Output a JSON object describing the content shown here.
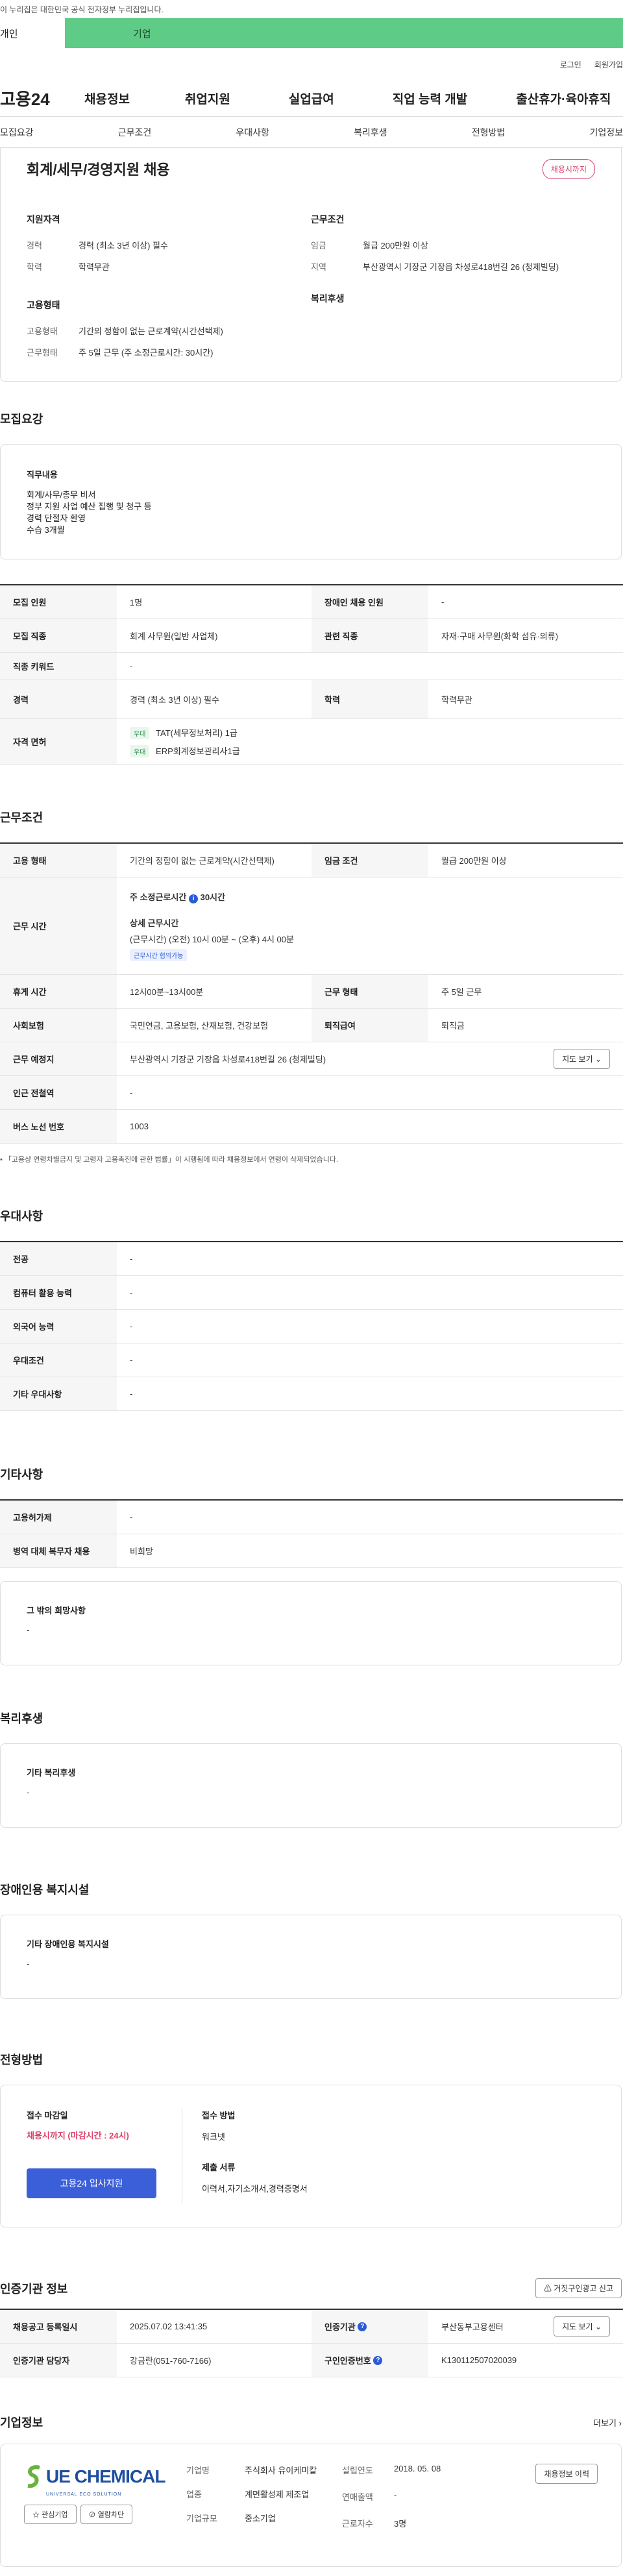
{
  "topbar": {
    "notice": "이 누리집은 대한민국 공식 전자정부 누리집입니다."
  },
  "tabs": {
    "individual": "개인",
    "corporate": "기업"
  },
  "util": {
    "login": "로그인",
    "signup": "회원가입"
  },
  "gnb": {
    "logo": "고용24",
    "menu": [
      "채용정보",
      "취업지원",
      "실업급여",
      "직업 능력 개발",
      "출산휴가·육아휴직"
    ]
  },
  "subnav": [
    "모집요강",
    "근무조건",
    "우대사항",
    "복리후생",
    "전형방법",
    "기업정보"
  ],
  "summary": {
    "title": "회계/세무/경영지원 채용",
    "status": "채용시까지",
    "qual_title": "지원자격",
    "work_title": "근무조건",
    "emp_title": "고용형태",
    "welfare_title": "복리후생",
    "career_k": "경력",
    "career_v": "경력 (최소 3년 이상) 필수",
    "edu_k": "학력",
    "edu_v": "학력무관",
    "wage_k": "임금",
    "wage_v": "월급 200만원 이상",
    "region_k": "지역",
    "region_v": "부산광역시 기장군 기장읍 차성로418번길 26 (청제빌딩)",
    "emptype_k": "고용형태",
    "emptype_v": "기간의 정함이 없는 근로계약(시간선택제)",
    "worktype_k": "근무형태",
    "worktype_v": "주 5일 근무 (주 소정근로시간: 30시간)"
  },
  "recruit": {
    "heading": "모집요강",
    "duty_title": "직무내용",
    "duty_lines": [
      "회계/사무/총무 비서",
      "정부 지원 사업 예산 집행 및 청구 등",
      "경력 단절자 환영",
      "수습 3개월"
    ],
    "num_label": "모집 인원",
    "num_val": "1명",
    "disabled_label": "장애인 채용 인원",
    "disabled_val": "-",
    "job_label": "모집 직종",
    "job_val": "회계 사무원(일반 사업체)",
    "rel_label": "관련 직종",
    "rel_val": "자재·구매 사무원(화학 섬유·의류)",
    "kw_label": "직종 키워드",
    "kw_val": "-",
    "career_label": "경력",
    "career_val": "경력 (최소 3년 이상) 필수",
    "edu_label": "학력",
    "edu_val": "학력무관",
    "cert_label": "자격 면허",
    "cert_badge": "우대",
    "certs": [
      "TAT(세무정보처리) 1급",
      "ERP회계정보관리사1급"
    ]
  },
  "condition": {
    "heading": "근무조건",
    "emp_label": "고용 형태",
    "emp_val": "기간의 정함이 없는 근로계약(시간선택제)",
    "wage_label": "임금 조건",
    "wage_val": "월급 200만원 이상",
    "hours_label": "근무 시간",
    "weekly": "주 소정근로시간",
    "weekly_val": "30시간",
    "detail_title": "상세 근무시간",
    "detail_val": "(근무시간) (오전) 10시 00분 ~ (오후) 4시 00분",
    "nego": "근무시간 협의가능",
    "break_label": "휴게 시간",
    "break_val": "12시00분~13시00분",
    "form_label": "근무 형태",
    "form_val": "주 5일 근무",
    "ins_label": "사회보험",
    "ins_val": "국민연금, 고용보험, 산재보험, 건강보험",
    "sev_label": "퇴직급여",
    "sev_val": "퇴직금",
    "place_label": "근무 예정지",
    "place_val": "부산광역시 기장군 기장읍 차성로418번길 26 (청제빌딩)",
    "map_btn": "지도 보기",
    "station_label": "인근 전철역",
    "station_val": "-",
    "bus_label": "버스 노선 번호",
    "bus_val": "1003",
    "footnote": "「고용상 연령차별금지 및 고령자 고용촉진에 관한 법률」이 시행됨에 따라 채용정보에서 연령이 삭제되었습니다."
  },
  "pref": {
    "heading": "우대사항",
    "rows": [
      {
        "label": "전공",
        "val": "-"
      },
      {
        "label": "컴퓨터 활용 능력",
        "val": "-"
      },
      {
        "label": "외국어 능력",
        "val": "-"
      },
      {
        "label": "우대조건",
        "val": "-"
      },
      {
        "label": "기타 우대사항",
        "val": "-"
      }
    ]
  },
  "other": {
    "heading": "기타사항",
    "rows": [
      {
        "label": "고용허가제",
        "val": "-"
      },
      {
        "label": "병역 대체 복무자 채용",
        "val": "비희망"
      }
    ],
    "wish_title": "그 밖의 희망사항",
    "wish_val": "-"
  },
  "welfare": {
    "heading": "복리후생",
    "title": "기타 복리후생",
    "val": "-"
  },
  "disabled": {
    "heading": "장애인용 복지시설",
    "title": "기타 장애인용 복지시설",
    "val": "-"
  },
  "selection": {
    "heading": "전형방법",
    "deadline_title": "접수 마감일",
    "deadline_val": "채용시까지 (마감시간 : 24시)",
    "apply_btn": "고용24 입사지원",
    "method_title": "접수 방법",
    "method_val": "워크넷",
    "docs_title": "제출 서류",
    "docs_val": "이력서,자기소개서,경력증명서"
  },
  "agency": {
    "heading": "인증기관 정보",
    "report_btn": "거짓구인광고 신고",
    "reg_label": "채용공고 등록일시",
    "reg_val": "2025.07.02 13:41:35",
    "org_label": "인증기관",
    "org_val": "부산동부고용센터",
    "map_btn": "지도 보기",
    "mgr_label": "인증기관 담당자",
    "mgr_val": "강금란(051-760-7166)",
    "num_label": "구인인증번호",
    "num_val": "K130112507020039"
  },
  "company": {
    "heading": "기업정보",
    "more": "더보기",
    "logo_text": "UE CHEMICAL",
    "logo_sub": "UNIVERSAL ECO SOLUTION",
    "fav_btn": "관심기업",
    "block_btn": "열람차단",
    "name_k": "기업명",
    "name_v": "주식회사 유이케미칼",
    "ind_k": "업종",
    "ind_v": "계면활성제 제조업",
    "size_k": "기업규모",
    "size_v": "중소기업",
    "year_k": "설립연도",
    "year_v": "2018. 05. 08",
    "sales_k": "연매출액",
    "sales_v": "-",
    "emp_k": "근로자수",
    "emp_v": "3명",
    "hire_btn": "채용정보 이력",
    "accent": "#1f4fa0",
    "green": "#6ab23e"
  }
}
